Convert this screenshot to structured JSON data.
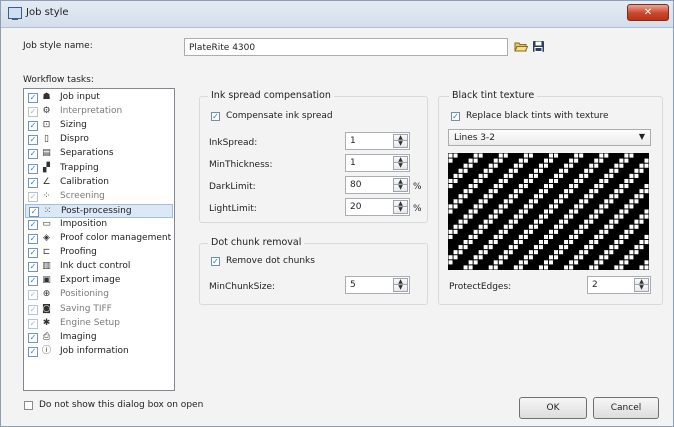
{
  "window": {
    "title": "Job style",
    "close_glyph": "✕"
  },
  "job_style_name": {
    "label": "Job style name:",
    "value": "PlateRite 4300",
    "open_icon": "folder-open-icon",
    "save_icon": "floppy-disk-icon"
  },
  "workflow": {
    "label": "Workflow tasks:",
    "tasks": [
      {
        "label": "Job input",
        "icon": "☗",
        "checked": true,
        "disabled": false
      },
      {
        "label": "Interpretation",
        "icon": "⚙",
        "checked": true,
        "disabled": true
      },
      {
        "label": "Sizing",
        "icon": "⊡",
        "checked": true,
        "disabled": false
      },
      {
        "label": "Dispro",
        "icon": "▯",
        "checked": true,
        "disabled": false
      },
      {
        "label": "Separations",
        "icon": "▤",
        "checked": true,
        "disabled": false
      },
      {
        "label": "Trapping",
        "icon": "▞",
        "checked": true,
        "disabled": false
      },
      {
        "label": "Calibration",
        "icon": "∠",
        "checked": true,
        "disabled": false
      },
      {
        "label": "Screening",
        "icon": "⁘",
        "checked": true,
        "disabled": true
      },
      {
        "label": "Post-processing",
        "icon": "⁙",
        "checked": true,
        "disabled": false
      },
      {
        "label": "Imposition",
        "icon": "▭",
        "checked": true,
        "disabled": false
      },
      {
        "label": "Proof color management",
        "icon": "◈",
        "checked": true,
        "disabled": false
      },
      {
        "label": "Proofing",
        "icon": "⊏",
        "checked": true,
        "disabled": false
      },
      {
        "label": "Ink duct control",
        "icon": "▥",
        "checked": true,
        "disabled": false
      },
      {
        "label": "Export image",
        "icon": "▣",
        "checked": true,
        "disabled": false
      },
      {
        "label": "Positioning",
        "icon": "⊕",
        "checked": true,
        "disabled": true
      },
      {
        "label": "Saving TIFF",
        "icon": "◙",
        "checked": true,
        "disabled": true
      },
      {
        "label": "Engine Setup",
        "icon": "✱",
        "checked": true,
        "disabled": true
      },
      {
        "label": "Imaging",
        "icon": "⎙",
        "checked": true,
        "disabled": false
      },
      {
        "label": "Job information",
        "icon": "ⓘ",
        "checked": true,
        "disabled": false
      }
    ],
    "selected_index": 8
  },
  "ink_spread": {
    "title": "Ink spread compensation",
    "compensate_label": "Compensate ink spread",
    "compensate_checked": true,
    "fields": [
      {
        "label": "InkSpread:",
        "value": "1",
        "unit": ""
      },
      {
        "label": "MinThickness:",
        "value": "1",
        "unit": ""
      },
      {
        "label": "DarkLimit:",
        "value": "80",
        "unit": "%"
      },
      {
        "label": "LightLimit:",
        "value": "20",
        "unit": "%"
      }
    ]
  },
  "dot_chunk": {
    "title": "Dot chunk removal",
    "remove_label": "Remove dot chunks",
    "remove_checked": true,
    "min_chunk_label": "MinChunkSize:",
    "min_chunk_value": "5"
  },
  "black_tint": {
    "title": "Black tint texture",
    "replace_label": "Replace black tints with texture",
    "replace_checked": true,
    "texture_selected": "Lines 3-2",
    "protect_edges_label": "ProtectEdges:",
    "protect_edges_value": "2",
    "pattern_colors": {
      "ink": "#000000",
      "paper": "#ffffff"
    }
  },
  "footer": {
    "dont_show_label": "Do not show this dialog box on open",
    "dont_show_checked": false,
    "ok_label": "OK",
    "cancel_label": "Cancel"
  },
  "check_glyph": "✓"
}
